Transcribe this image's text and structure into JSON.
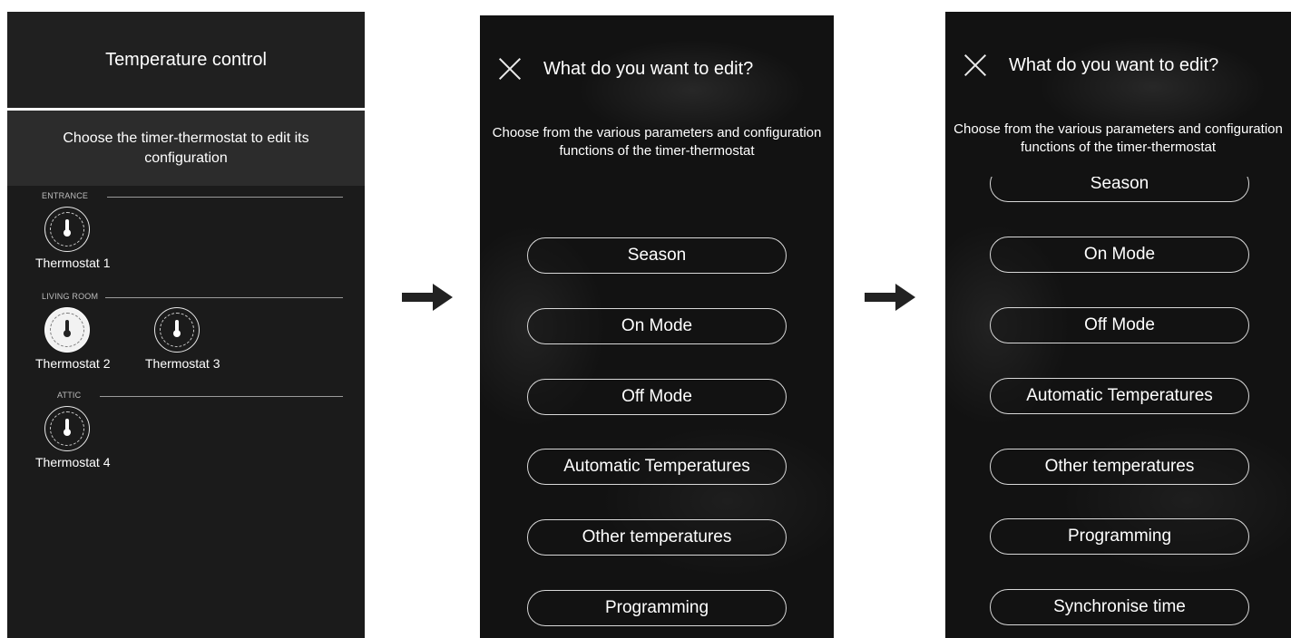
{
  "screen1": {
    "title": "Temperature control",
    "subtitle": "Choose the timer-thermostat to edit its configuration",
    "sections": [
      {
        "label": "ENTRANCE",
        "thermostats": [
          {
            "name": "Thermostat 1",
            "selected": false
          }
        ]
      },
      {
        "label": "LIVING ROOM",
        "thermostats": [
          {
            "name": "Thermostat 2",
            "selected": true
          },
          {
            "name": "Thermostat 3",
            "selected": false
          }
        ]
      },
      {
        "label": "ATTIC",
        "thermostats": [
          {
            "name": "Thermostat 4",
            "selected": false
          }
        ]
      }
    ]
  },
  "screen2": {
    "title": "What do you want to edit?",
    "description": "Choose from the various parameters and configuration functions of the timer-thermostat",
    "options": [
      "Season",
      "On Mode",
      "Off Mode",
      "Automatic Temperatures",
      "Other temperatures",
      "Programming"
    ]
  },
  "screen3": {
    "title": "What do you want to edit?",
    "description": "Choose from the various parameters and configuration functions of the timer-thermostat",
    "options": [
      "Season",
      "On Mode",
      "Off Mode",
      "Automatic Temperatures",
      "Other temperatures",
      "Programming",
      "Synchronise time"
    ]
  },
  "icons": {
    "close": "close-icon",
    "arrow": "arrow-right-icon",
    "thermostat": "thermostat-dial-icon"
  },
  "colors": {
    "background": "#121212",
    "panel": "#1b1b1b",
    "text": "#ffffff",
    "button_border": "#d8d8d8"
  }
}
